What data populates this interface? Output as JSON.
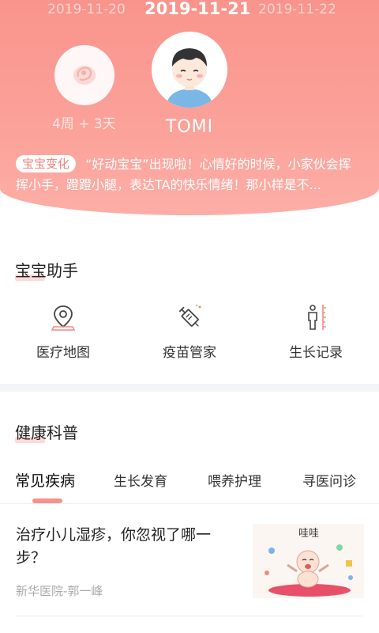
{
  "header": {
    "date_prev": "2019-11-20",
    "date_current": "2019-11-21",
    "date_next": "2019-11-22",
    "gestation": "4周 + 3天",
    "baby_name": "TOMI",
    "change_tag": "宝宝变化",
    "change_text": "“好动宝宝”出现啦！心情好的时候，小家伙会挥挥小手，蹬蹬小腿，表达TA的快乐情绪！那小样是不..."
  },
  "assistant": {
    "title": "宝宝助手",
    "items": [
      {
        "label": "医疗地图",
        "icon": "map-pin-icon"
      },
      {
        "label": "疫苗管家",
        "icon": "syringe-icon"
      },
      {
        "label": "生长记录",
        "icon": "height-ruler-icon"
      }
    ]
  },
  "health": {
    "title": "健康科普",
    "tabs": [
      {
        "label": "常见疾病",
        "active": true
      },
      {
        "label": "生长发育",
        "active": false
      },
      {
        "label": "喂养护理",
        "active": false
      },
      {
        "label": "寻医问诊",
        "active": false
      }
    ],
    "articles": [
      {
        "title": "治疗小儿湿疹，你忽视了哪一步？",
        "source": "新华医院-郭一峰",
        "thumb_text": "哇哇"
      }
    ]
  },
  "colors": {
    "accent": "#f9948c",
    "text": "#333333",
    "muted": "#aaaaaa"
  }
}
